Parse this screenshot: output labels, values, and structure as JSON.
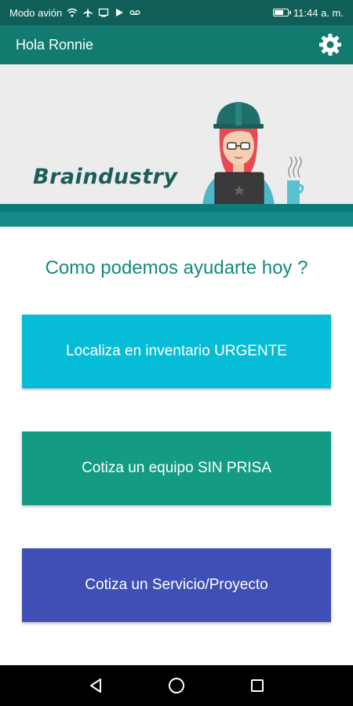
{
  "status_bar": {
    "left_text": "Modo avión",
    "time": "11:44 a. m.",
    "battery_level": 0.75,
    "icons": [
      "wifi-icon",
      "airplane-icon",
      "cast-icon",
      "play-icon",
      "voicemail-icon",
      "battery-icon"
    ]
  },
  "app_bar": {
    "greeting": "Hola Ronnie",
    "settings_icon": "gear-icon"
  },
  "banner": {
    "brand": "Braindustry"
  },
  "main": {
    "question": "Como podemos ayudarte hoy ?",
    "buttons": [
      {
        "label": "Localiza en inventario URGENTE",
        "color": "#07bcd6"
      },
      {
        "label": "Cotiza un equipo SIN PRISA",
        "color": "#139b84"
      },
      {
        "label": "Cotiza un Servicio/Proyecto",
        "color": "#3f4fb5"
      }
    ]
  },
  "nav_bar": {
    "icons": [
      "back-icon",
      "home-icon",
      "recents-icon"
    ]
  },
  "colors": {
    "status_bar": "#0f5f58",
    "app_bar": "#137a70",
    "accent_text": "#138a7f"
  }
}
